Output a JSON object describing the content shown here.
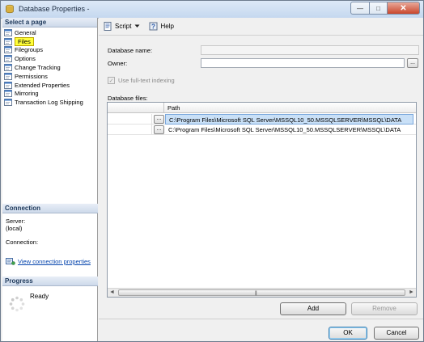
{
  "window": {
    "title": "Database Properties -",
    "min_glyph": "—",
    "max_glyph": "□",
    "close_glyph": "✕"
  },
  "left": {
    "select_page_header": "Select a page",
    "pages": [
      {
        "label": "General",
        "icon": "page-icon"
      },
      {
        "label": "Files",
        "icon": "page-icon",
        "selected": true
      },
      {
        "label": "Filegroups",
        "icon": "page-icon"
      },
      {
        "label": "Options",
        "icon": "page-icon"
      },
      {
        "label": "Change Tracking",
        "icon": "page-icon"
      },
      {
        "label": "Permissions",
        "icon": "page-icon"
      },
      {
        "label": "Extended Properties",
        "icon": "page-icon"
      },
      {
        "label": "Mirroring",
        "icon": "page-icon"
      },
      {
        "label": "Transaction Log Shipping",
        "icon": "page-icon"
      }
    ],
    "connection_header": "Connection",
    "server_label": "Server:",
    "server_value": "(local)",
    "connection_label": "Connection:",
    "connection_value": "",
    "view_connection_link": "View connection properties",
    "progress_header": "Progress",
    "progress_status": "Ready"
  },
  "toolbar": {
    "script_label": "Script",
    "help_label": "Help"
  },
  "form": {
    "database_name_label": "Database name:",
    "database_name_value": "",
    "owner_label": "Owner:",
    "owner_value": "",
    "owner_browse": "...",
    "fulltext_label": "Use full-text indexing",
    "fulltext_checked": true,
    "database_files_label": "Database files:"
  },
  "grid": {
    "columns": [
      "",
      "Path"
    ],
    "rows": [
      {
        "path": "C:\\Program Files\\Microsoft SQL Server\\MSSQL10_50.MSSQLSERVER\\MSSQL\\DATA",
        "selected": true,
        "browse": "..."
      },
      {
        "path": "C:\\Program Files\\Microsoft SQL Server\\MSSQL10_50.MSSQLSERVER\\MSSQL\\DATA",
        "selected": false,
        "browse": "..."
      }
    ],
    "scroll_left": "◄",
    "scroll_right": "►",
    "scroll_grip": "|||"
  },
  "buttons": {
    "add": "Add",
    "remove": "Remove",
    "ok": "OK",
    "cancel": "Cancel"
  }
}
